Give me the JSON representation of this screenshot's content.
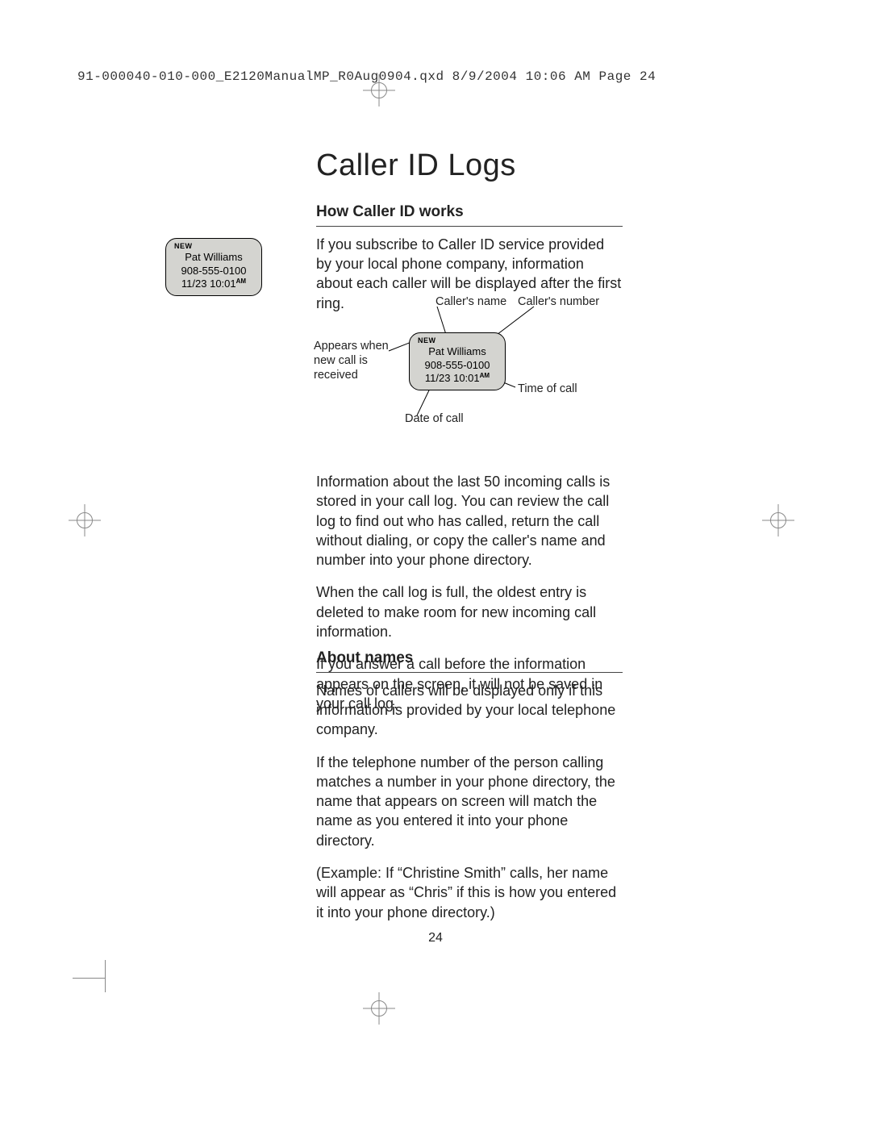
{
  "slug": "91-000040-010-000_E2120ManualMP_R0Aug0904.qxd  8/9/2004  10:06 AM  Page 24",
  "title": "Caller ID Logs",
  "section1": {
    "heading": "How Caller ID works",
    "p1": "If you subscribe to Caller ID service provided by your local phone company, information about each caller will be displayed after the first ring."
  },
  "lcd": {
    "new": "NEW",
    "name": "Pat Williams",
    "number": "908-555-0100",
    "datetime": "11/23 10:01",
    "ampm": "AM"
  },
  "diagram": {
    "label_new": "Appears when new call is received",
    "label_name": "Caller's name",
    "label_number": "Caller's number",
    "label_time": "Time of call",
    "label_date": "Date of call"
  },
  "section2": {
    "p1": "Information about the last 50 incoming calls is stored in your call log. You can review the call log to find out who has called, return the call without dialing, or copy the caller's name and number into your phone directory.",
    "p2": "When the call log is full, the oldest entry is deleted to make room for new incoming call information.",
    "p3": "If you answer a call before the information appears on the screen, it will not be saved in your call log."
  },
  "section3": {
    "heading": "About names",
    "p1": "Names of callers will be displayed only if this information is provided by your local telephone company.",
    "p2": "If the telephone number of the person calling matches a number in your phone directory, the name that appears on screen will match the name as you entered it into your phone directory.",
    "p3": "(Example: If “Christine Smith” calls, her name will appear as “Chris” if this is how you entered it into your phone directory.)"
  },
  "page_number": "24"
}
